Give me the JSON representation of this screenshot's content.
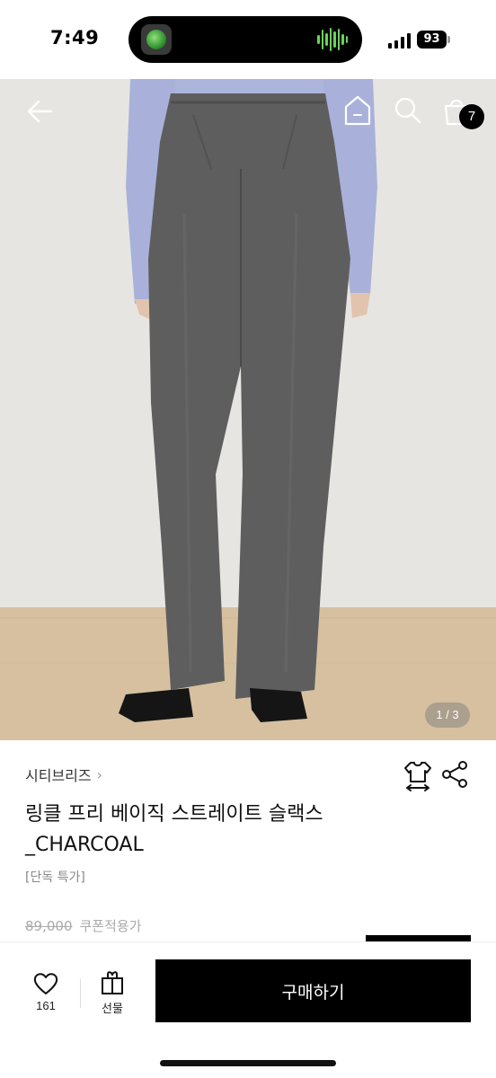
{
  "status_bar": {
    "time": "7:49",
    "battery": "93"
  },
  "hero": {
    "page_indicator": "1 / 3",
    "cart_count": "7"
  },
  "product": {
    "brand": "시티브리즈",
    "title": "링클 프리 베이직 스트레이트 슬랙스 _CHARCOAL",
    "tag": "[단독 특가]",
    "original_price": "89,000",
    "coupon_text": "쿠폰적용가"
  },
  "bottom_bar": {
    "like_count": "161",
    "gift_label": "선물",
    "buy_label": "구매하기"
  },
  "colors": {
    "accent": "#000000",
    "badge": "#000000",
    "pants": "#5e5e5e",
    "shirt": "#a9b1da",
    "floor": "#d6c09f"
  },
  "icons": [
    "back-arrow-icon",
    "home-icon",
    "search-icon",
    "shopping-bag-icon",
    "fit-size-icon",
    "share-icon",
    "heart-icon",
    "gift-icon"
  ]
}
